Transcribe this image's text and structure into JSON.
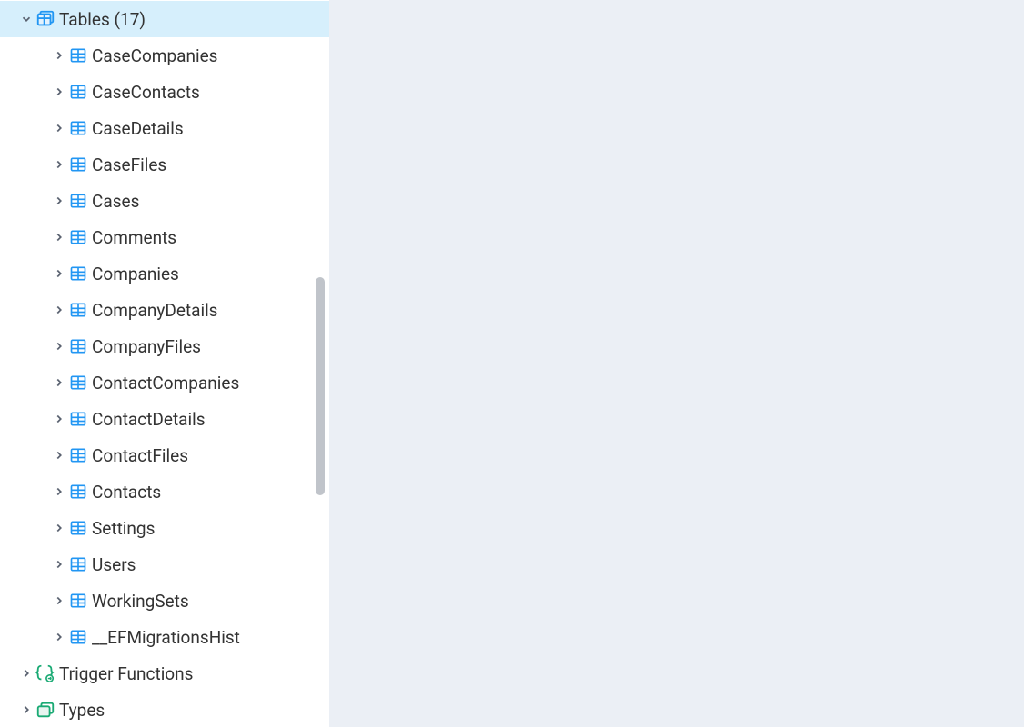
{
  "tree": {
    "tables_folder": {
      "label": "Tables (17)",
      "expanded": true
    },
    "tables": [
      {
        "name": "CaseCompanies"
      },
      {
        "name": "CaseContacts"
      },
      {
        "name": "CaseDetails"
      },
      {
        "name": "CaseFiles"
      },
      {
        "name": "Cases"
      },
      {
        "name": "Comments"
      },
      {
        "name": "Companies"
      },
      {
        "name": "CompanyDetails"
      },
      {
        "name": "CompanyFiles"
      },
      {
        "name": "ContactCompanies"
      },
      {
        "name": "ContactDetails"
      },
      {
        "name": "ContactFiles"
      },
      {
        "name": "Contacts"
      },
      {
        "name": "Settings"
      },
      {
        "name": "Users"
      },
      {
        "name": "WorkingSets"
      },
      {
        "name": "__EFMigrationsHist"
      }
    ],
    "trigger_functions": {
      "label": "Trigger Functions"
    },
    "types": {
      "label": "Types"
    }
  },
  "icons": {
    "tables_folder_color": "#2196f3",
    "table_color": "#2196f3",
    "trigger_color": "#1aaa74",
    "types_color": "#1aaa74"
  }
}
